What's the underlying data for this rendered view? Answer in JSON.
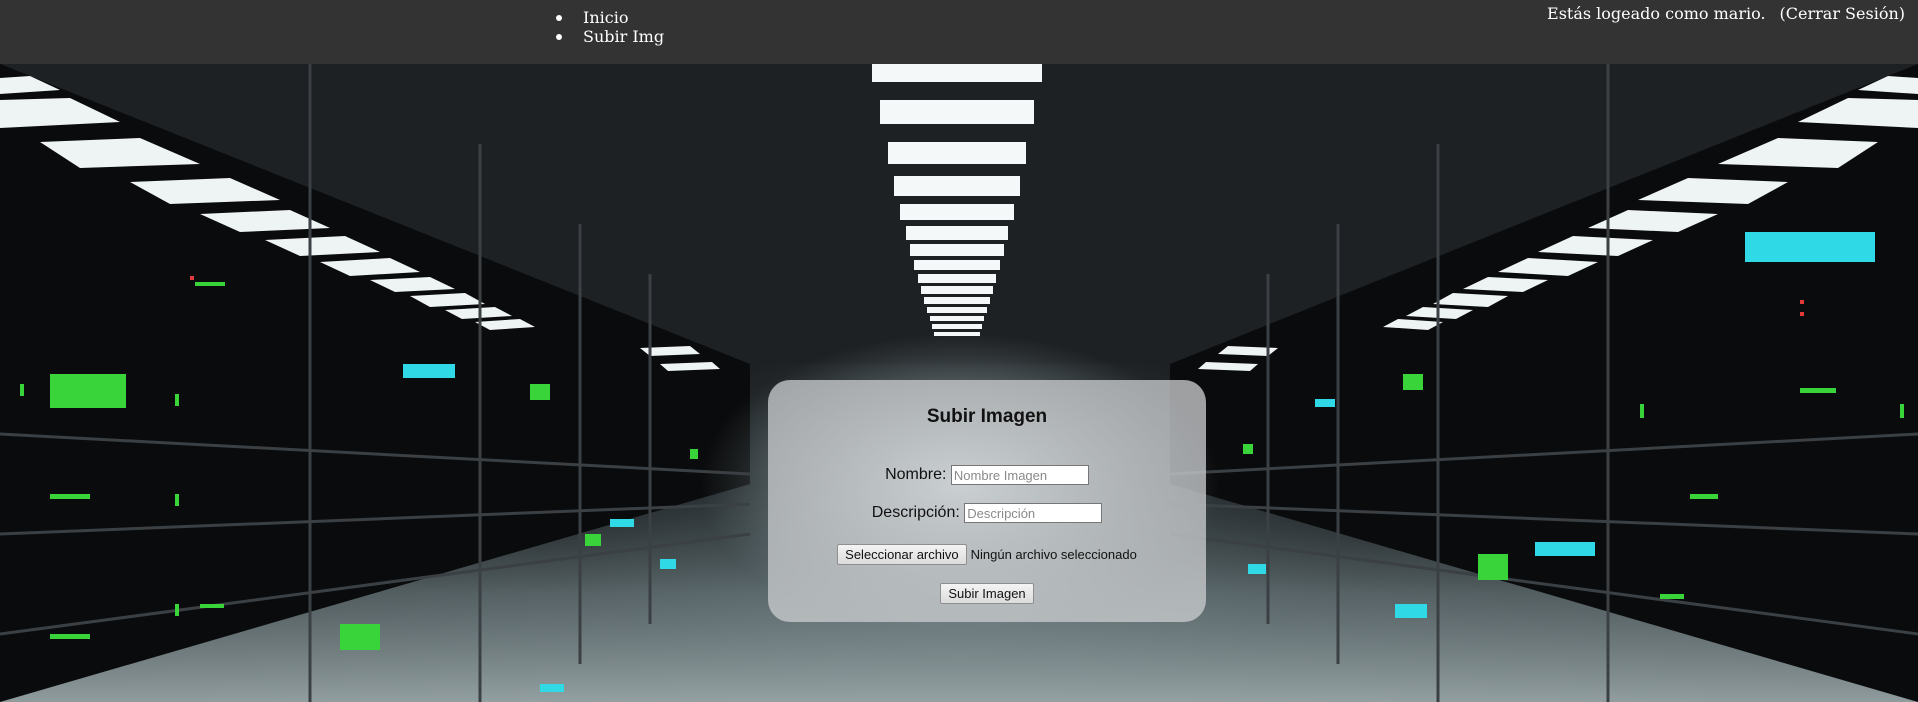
{
  "nav": {
    "items": [
      {
        "label": "Inicio"
      },
      {
        "label": "Subir Img"
      }
    ]
  },
  "user": {
    "status_text": "Estás logeado como mario.",
    "logout_label": "(Cerrar Sesión)"
  },
  "form": {
    "title": "Subir Imagen",
    "name_label": "Nombre:",
    "name_placeholder": "Nombre Imagen",
    "name_value": "",
    "desc_label": "Descripción:",
    "desc_placeholder": "Descripción",
    "desc_value": "",
    "file_button_label": "Seleccionar archivo",
    "file_status": "Ningún archivo seleccionado",
    "submit_label": "Subir Imagen"
  },
  "colors": {
    "topbar": "#333333",
    "card": "#c8cbcd",
    "server_led_green": "#39d43a",
    "server_led_cyan": "#2fd9e6"
  }
}
